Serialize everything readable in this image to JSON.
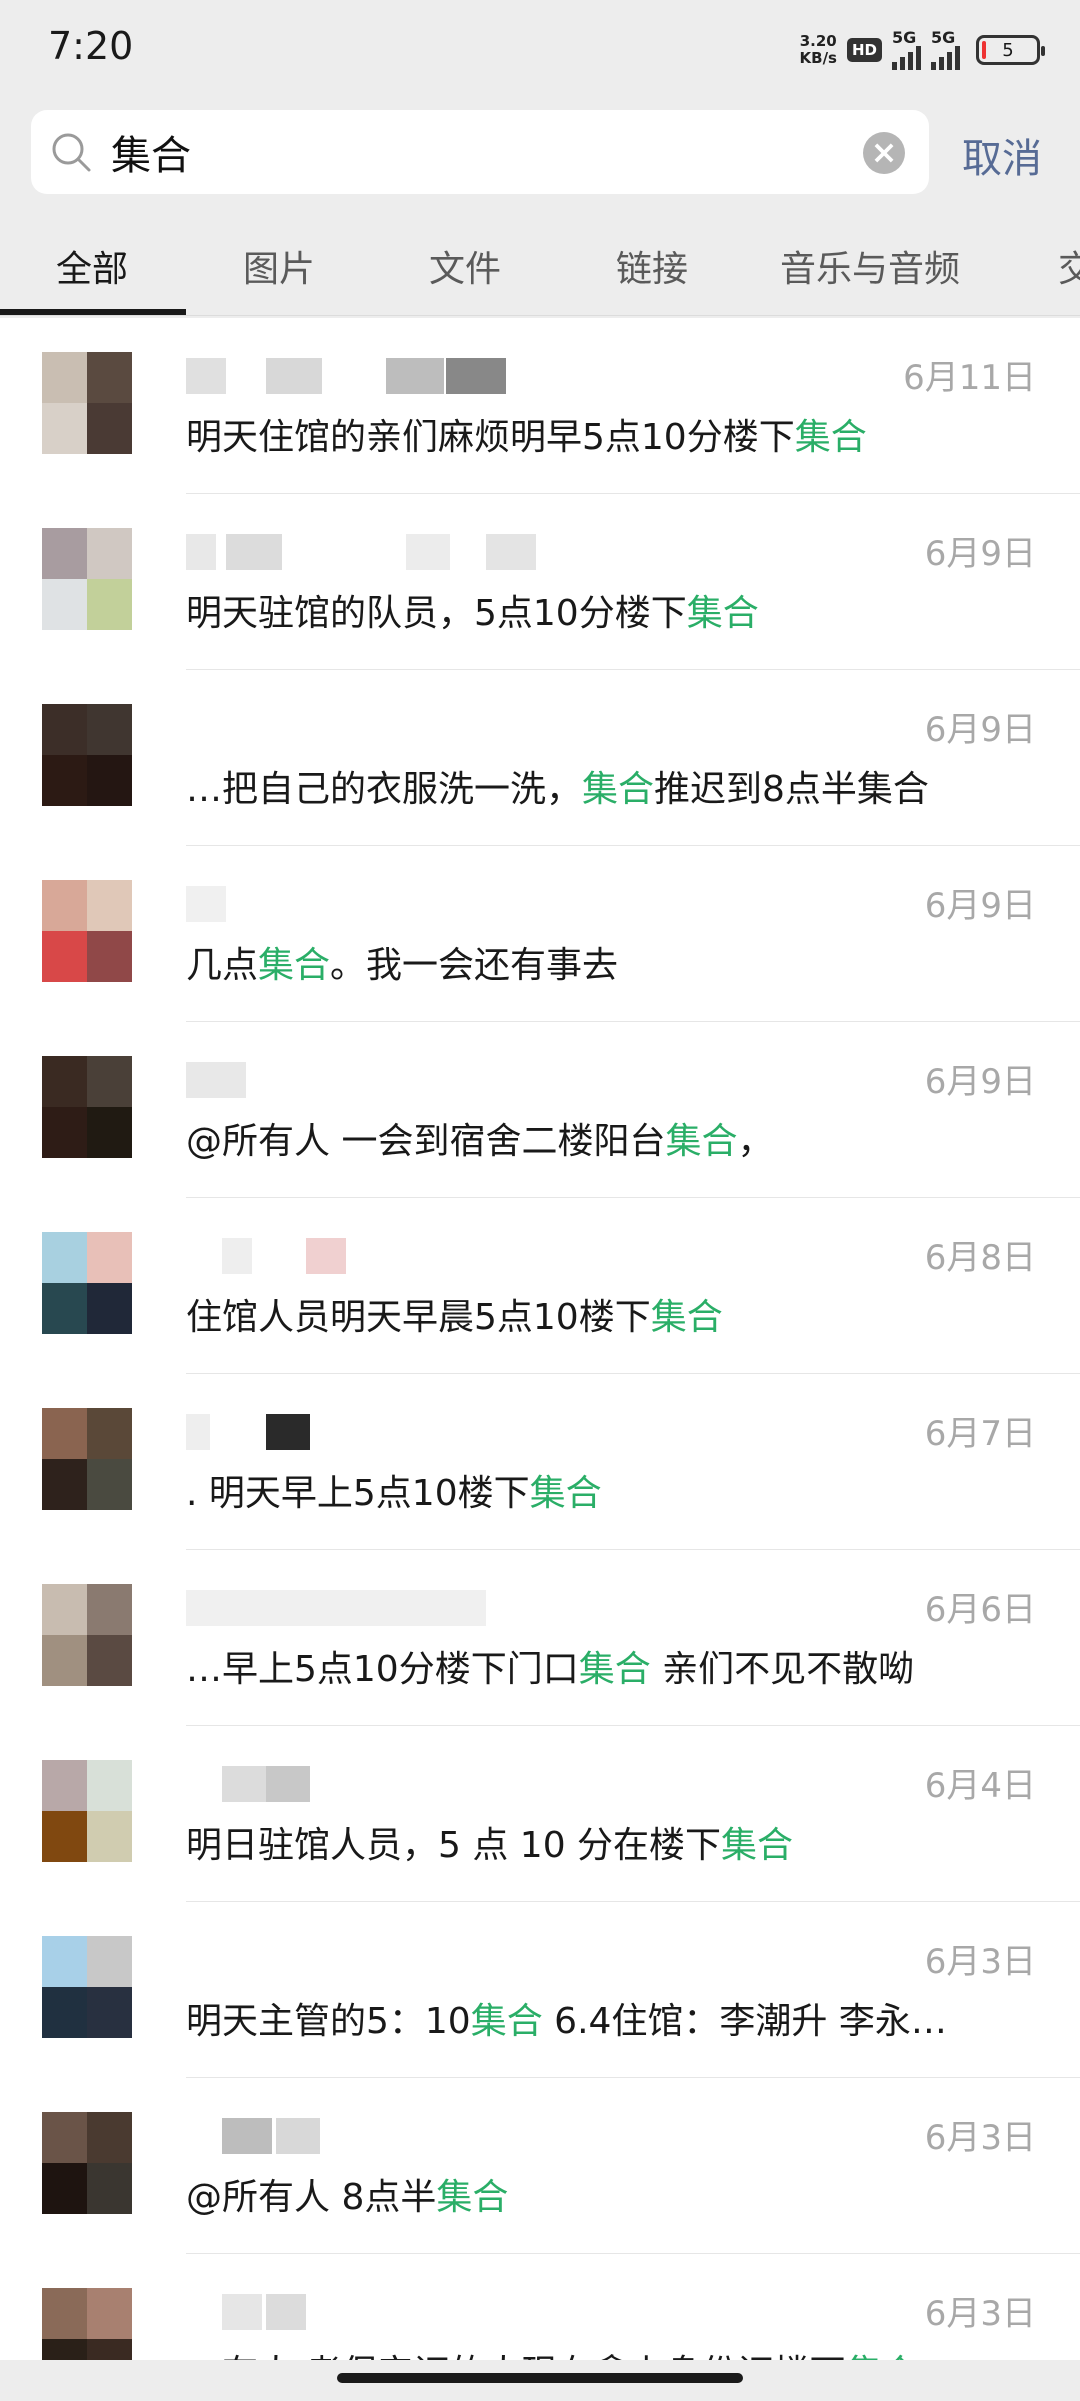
{
  "status_bar": {
    "time": "7:20",
    "net_speed_value": "3.20",
    "net_speed_unit": "KB/s",
    "hd_badge": "HD",
    "signal_1": "5G",
    "signal_2": "5G",
    "battery": "5"
  },
  "search": {
    "query": "集合",
    "cancel_label": "取消"
  },
  "tabs": [
    {
      "label": "全部",
      "active": true
    },
    {
      "label": "图片"
    },
    {
      "label": "文件"
    },
    {
      "label": "链接"
    },
    {
      "label": "音乐与音频"
    },
    {
      "label": "交"
    }
  ],
  "results": [
    {
      "date": "6月11日",
      "pre": "明天住馆的亲们麻烦明早5点10分楼下",
      "hl": "集合",
      "post": "",
      "avatar": [
        "#c9beb2",
        "#5a4a40",
        "#d8d0c8",
        "#4a3a34"
      ]
    },
    {
      "date": "6月9日",
      "pre": "明天驻馆的队员，5点10分楼下",
      "hl": "集合",
      "post": "",
      "avatar": [
        "#a89ca0",
        "#d0c8c2",
        "#dfe2e4",
        "#c2d09a"
      ]
    },
    {
      "date": "6月9日",
      "pre": "…把自己的衣服洗一洗，",
      "hl": "集合",
      "post": "推迟到8点半集合",
      "avatar": [
        "#3c2e28",
        "#403630",
        "#2c1a14",
        "#241612"
      ]
    },
    {
      "date": "6月9日",
      "pre": "几点",
      "hl": "集合",
      "post": "。我一会还有事去",
      "avatar": [
        "#d8a898",
        "#e0c8b8",
        "#d84848",
        "#904848"
      ]
    },
    {
      "date": "6月9日",
      "pre": "@所有人 一会到宿舍二楼阳台",
      "hl": "集合",
      "post": "，",
      "avatar": [
        "#3a2a22",
        "#4a4038",
        "#2e1c16",
        "#201a12"
      ]
    },
    {
      "date": "6月8日",
      "pre": "住馆人员明天早晨5点10楼下",
      "hl": "集合",
      "post": "",
      "avatar": [
        "#a8d0e0",
        "#e8c0b8",
        "#284850",
        "#202838"
      ]
    },
    {
      "date": "6月7日",
      "pre": ".                        明天早上5点10楼下",
      "hl": "集合",
      "post": "",
      "avatar": [
        "#8a6450",
        "#5a4838",
        "#2e221c",
        "#4a4a40"
      ]
    },
    {
      "date": "6月6日",
      "pre": "…早上5点10分楼下门口",
      "hl": "集合",
      "post": " 亲们不见不散呦",
      "avatar": [
        "#c8bcb0",
        "#8a7a70",
        "#a09080",
        "#5a4a42"
      ]
    },
    {
      "date": "6月4日",
      "pre": " 明日驻馆人员，5 点 10 分在楼下",
      "hl": "集合",
      "post": "",
      "avatar": [
        "#b8a8a8",
        "#d8e0d8",
        "#804810",
        "#d0ccb0"
      ]
    },
    {
      "date": "6月3日",
      "pre": "明天主管的5：10",
      "hl": "集合",
      "post": " 6.4住馆：李潮升 李永…",
      "avatar": [
        "#a8d0e8",
        "#c8c8c8",
        "#203040",
        "#283040"
      ]
    },
    {
      "date": "6月3日",
      "pre": "@所有人 8点半",
      "hl": "集合",
      "post": "",
      "avatar": [
        "#6a5448",
        "#4a3a30",
        "#1e1410",
        "#3a3630"
      ]
    },
    {
      "date": "6月3日",
      "pre": "…有人 考保安证的人现在拿上身份证楼下",
      "hl": "集合",
      "post": "",
      "avatar": [
        "#8a6a58",
        "#a88070",
        "#2a2018",
        "#3a2a22"
      ]
    }
  ]
}
